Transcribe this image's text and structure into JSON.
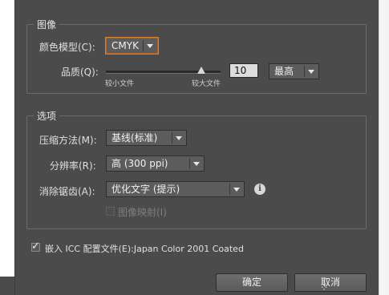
{
  "image_group": {
    "title": "图像",
    "color_model_label": "颜色模型(C):",
    "color_model_value": "CMYK",
    "quality_label": "品质(Q):",
    "quality_value": "10",
    "quality_preset": "最高",
    "quality_min_label": "较小文件",
    "quality_max_label": "较大文件"
  },
  "options_group": {
    "title": "选项",
    "compression_label": "压缩方法(M):",
    "compression_value": "基线(标准)",
    "resolution_label": "分辨率(R):",
    "resolution_value": "高 (300 ppi)",
    "antialias_label": "消除锯齿(A):",
    "antialias_value": "优化文字 (提示)",
    "image_map_label": "图像映射(I)",
    "image_map_checked": false
  },
  "embed_icc": {
    "checked": true,
    "label": "嵌入 ICC 配置文件(E):Japan Color 2001 Coated"
  },
  "buttons": {
    "ok": "确定",
    "cancel": "取消"
  },
  "colors": {
    "dialog_bg": "#4b4b4b",
    "focus_ring": "#d7822f"
  }
}
